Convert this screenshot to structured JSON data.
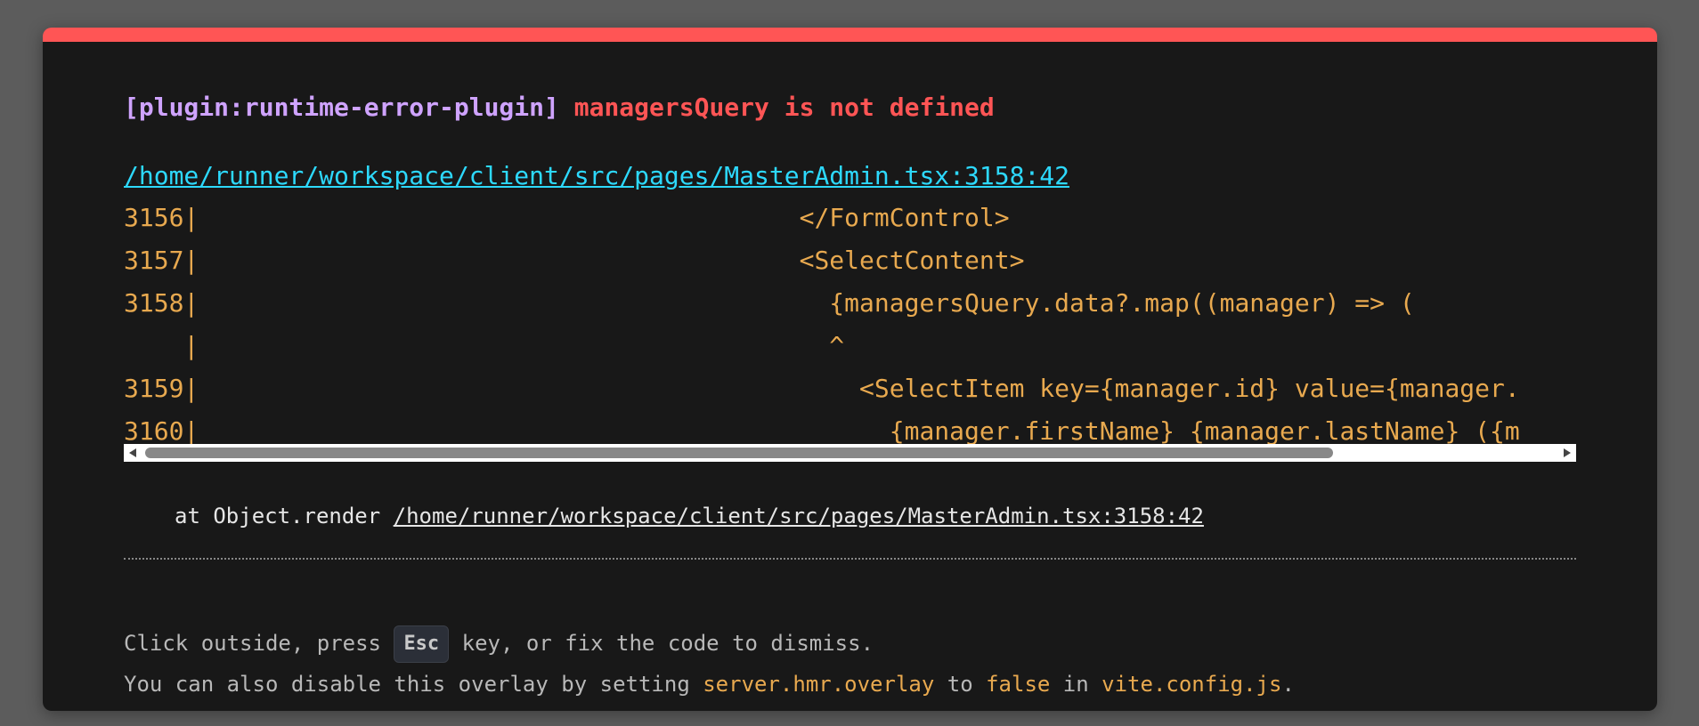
{
  "error": {
    "plugin_tag": "[plugin:runtime-error-plugin]",
    "message": "managersQuery is not defined",
    "file_link": "/home/runner/workspace/client/src/pages/MasterAdmin.tsx:3158:42"
  },
  "frame": {
    "lines": [
      "3156|                                        </FormControl>",
      "3157|                                        <SelectContent>",
      "3158|                                          {managersQuery.data?.map((manager) => (",
      "    |                                          ^",
      "3159|                                            <SelectItem key={manager.id} value={manager.",
      "3160|                                              {manager.firstName} {manager.lastName} ({m"
    ]
  },
  "stack": {
    "prefix": "at Object.render ",
    "link": "/home/runner/workspace/client/src/pages/MasterAdmin.tsx:3158:42"
  },
  "tip": {
    "line1_before": "Click outside, press ",
    "kbd": "Esc",
    "line1_after": " key, or fix the code to dismiss.",
    "line2_a": "You can also disable this overlay by setting ",
    "line2_code1": "server.hmr.overlay",
    "line2_b": " to ",
    "line2_code2": "false",
    "line2_c": " in ",
    "line2_code3": "vite.config.js",
    "line2_d": "."
  },
  "colors": {
    "accent_bar": "#ff5555",
    "plugin_tag": "#cfa3ff",
    "error_message": "#ff5555",
    "file_link": "#2dd9fe",
    "code": "#e8a94f",
    "background": "#181818"
  }
}
